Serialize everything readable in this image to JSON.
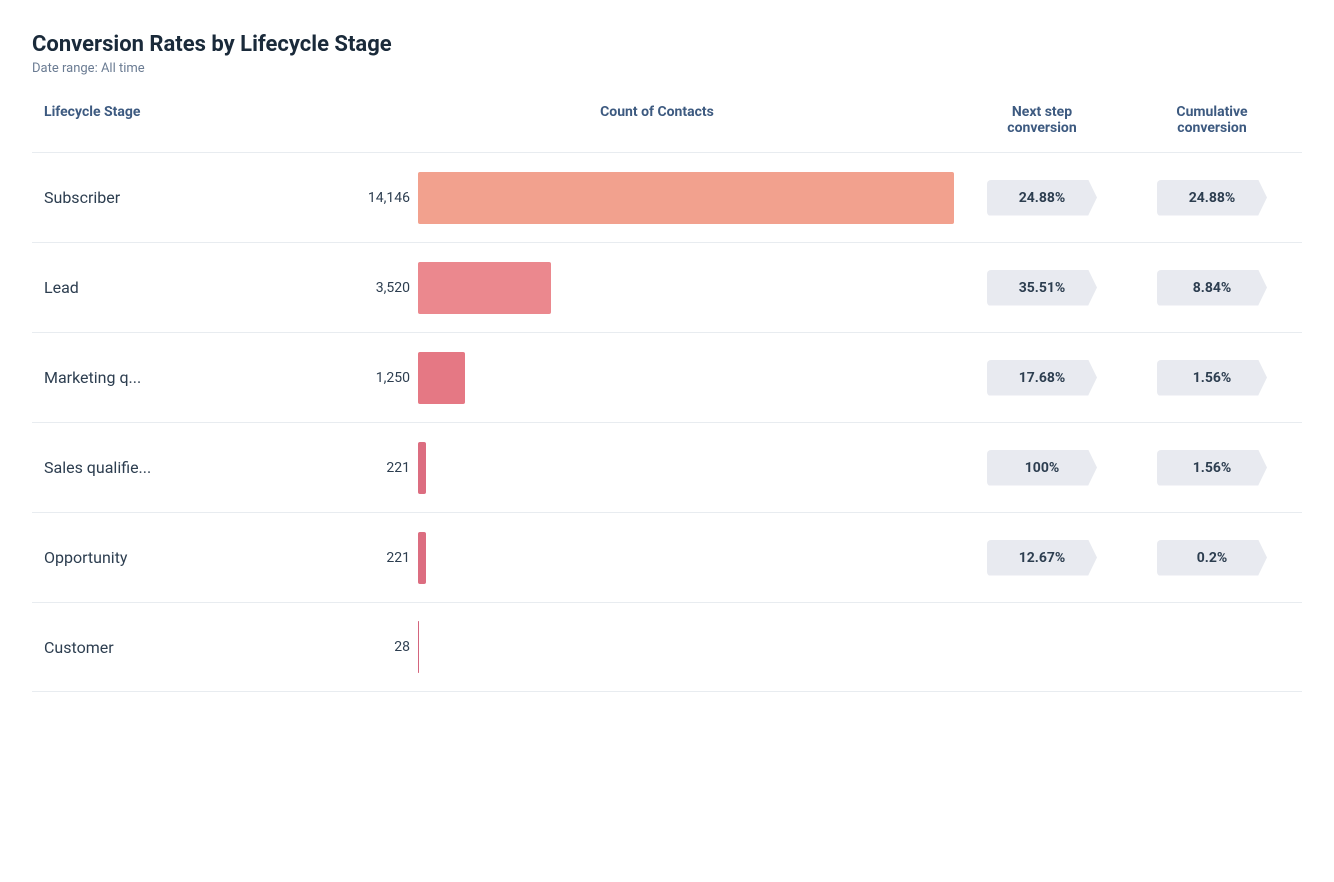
{
  "report": {
    "title": "Conversion Rates by Lifecycle Stage",
    "date_range_label": "Date range:",
    "date_range_value": "All time"
  },
  "columns": {
    "lifecycle_stage": "Lifecycle Stage",
    "count_of_contacts": "Count of Contacts",
    "next_step_conversion_line1": "Next step",
    "next_step_conversion_line2": "conversion",
    "cumulative_conversion_line1": "Cumulative",
    "cumulative_conversion_line2": "conversion"
  },
  "rows": [
    {
      "stage": "Subscriber",
      "count": "14,146",
      "count_raw": 14146,
      "bar_color": "#f0907a",
      "next_conversion": "24.88%",
      "cumulative_conversion": "24.88%",
      "is_last": false
    },
    {
      "stage": "Lead",
      "count": "3,520",
      "count_raw": 3520,
      "bar_color": "#e8737a",
      "next_conversion": "35.51%",
      "cumulative_conversion": "8.84%",
      "is_last": false
    },
    {
      "stage": "Marketing q...",
      "count": "1,250",
      "count_raw": 1250,
      "bar_color": "#e0606e",
      "next_conversion": "17.68%",
      "cumulative_conversion": "1.56%",
      "is_last": false
    },
    {
      "stage": "Sales qualifie...",
      "count": "221",
      "count_raw": 221,
      "bar_color": "#d6546a",
      "next_conversion": "100%",
      "cumulative_conversion": "1.56%",
      "is_last": false
    },
    {
      "stage": "Opportunity",
      "count": "221",
      "count_raw": 221,
      "bar_color": "#d6546a",
      "next_conversion": "12.67%",
      "cumulative_conversion": "0.2%",
      "is_last": false
    },
    {
      "stage": "Customer",
      "count": "28",
      "count_raw": 28,
      "bar_color": "#cc4a66",
      "next_conversion": "",
      "cumulative_conversion": "",
      "is_last": true
    }
  ],
  "max_count": 14146
}
